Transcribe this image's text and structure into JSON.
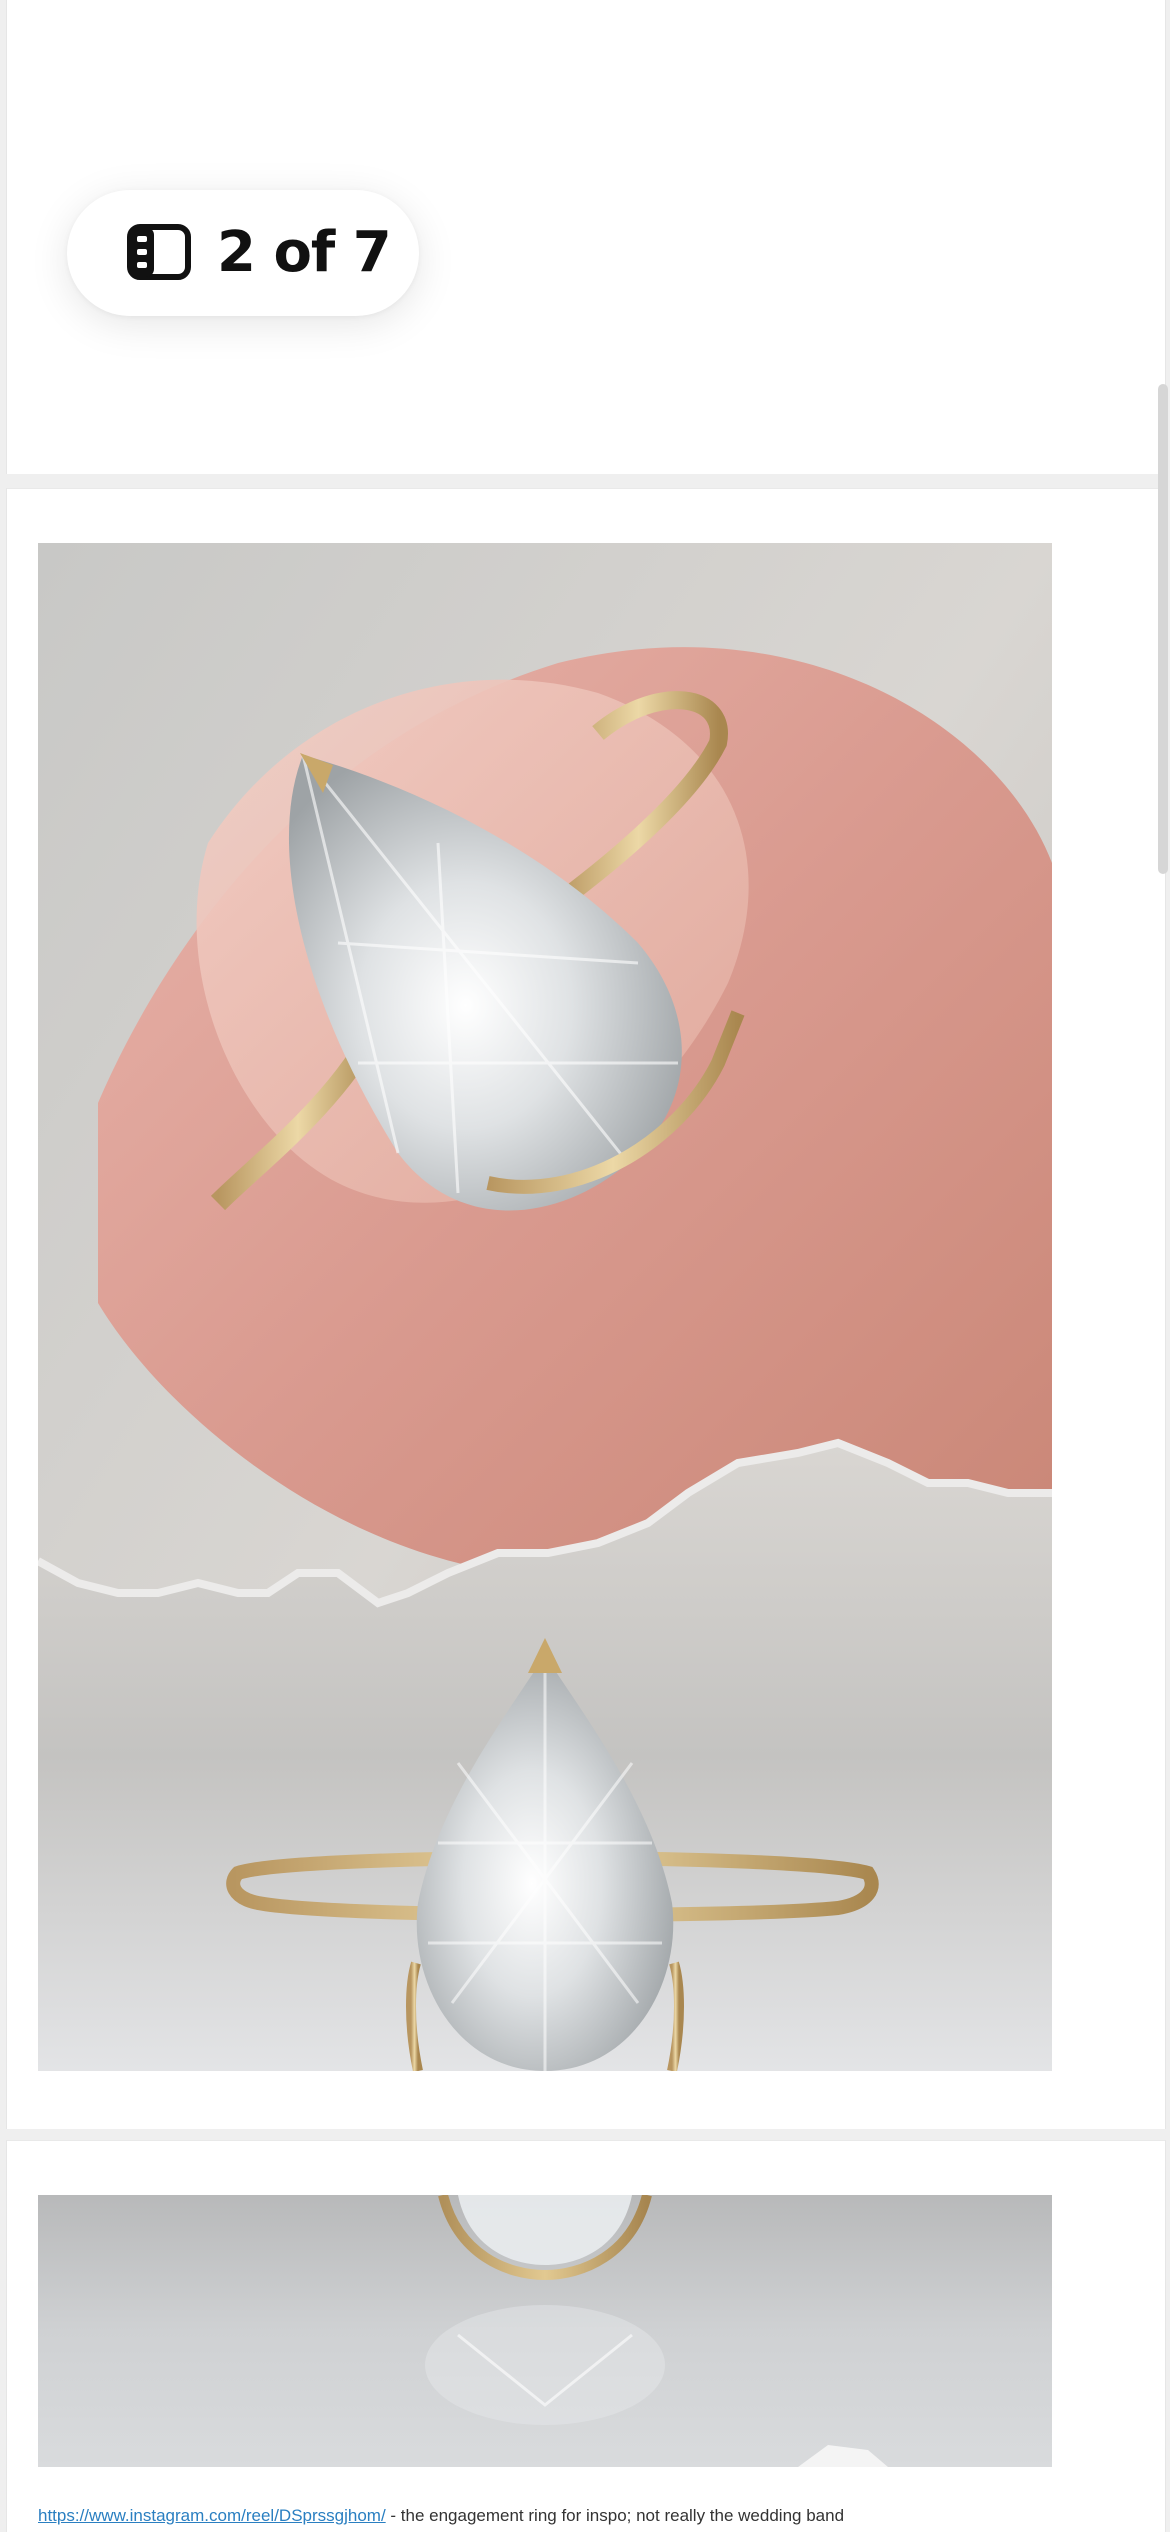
{
  "pager": {
    "icon": "sidebar-panel-icon",
    "label": "2 of 7"
  },
  "post": {
    "link_text": "https://www.instagram.com/reel/DSprssgjhom/",
    "description": " - the engagement ring for inspo; not really the wedding band"
  },
  "colors": {
    "accent_link": "#2a7fc1",
    "gold_band": "#c9a86a"
  }
}
